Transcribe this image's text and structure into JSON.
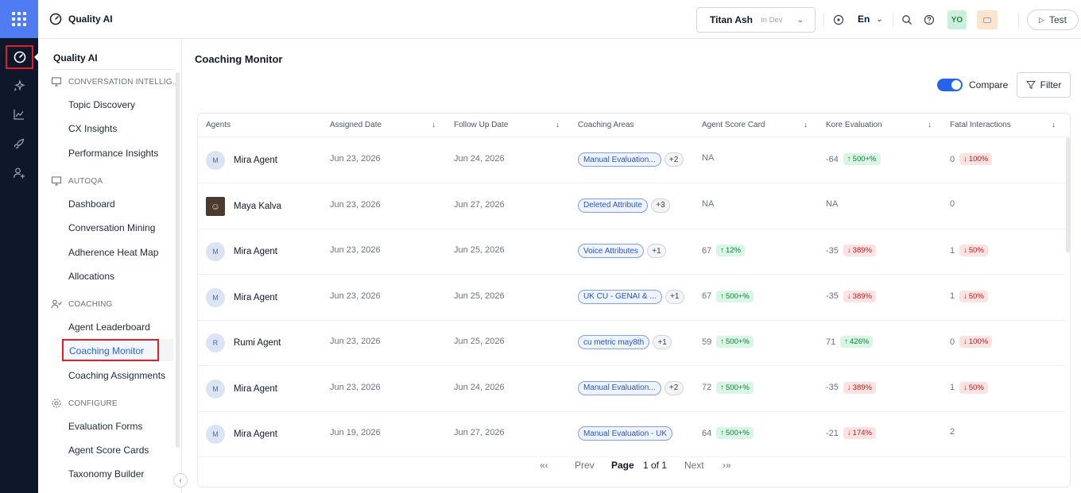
{
  "header": {
    "app_title": "Quality AI",
    "workspace_name": "Titan Ash",
    "workspace_env": "In Dev",
    "language": "En",
    "user_initials": "YO",
    "test_label": "Test"
  },
  "sidebar": {
    "title": "Quality AI",
    "sections": [
      {
        "label": "CONVERSATION INTELLIG...",
        "icon": "monitor-icon",
        "items": [
          "Topic Discovery",
          "CX Insights",
          "Performance Insights"
        ]
      },
      {
        "label": "AUTOQA",
        "icon": "monitor-icon",
        "items": [
          "Dashboard",
          "Conversation Mining",
          "Adherence Heat Map",
          "Allocations"
        ]
      },
      {
        "label": "COACHING",
        "icon": "users-icon",
        "items": [
          "Agent Leaderboard",
          "Coaching Monitor",
          "Coaching Assignments"
        ]
      },
      {
        "label": "CONFIGURE",
        "icon": "gear-icon",
        "items": [
          "Evaluation Forms",
          "Agent Score Cards",
          "Taxonomy Builder"
        ]
      }
    ],
    "active_item": "Coaching Monitor"
  },
  "main": {
    "title": "Coaching Monitor",
    "compare_label": "Compare",
    "compare_on": true,
    "filter_label": "Filter",
    "columns": [
      "Agents",
      "Assigned Date",
      "Follow Up Date",
      "Coaching Areas",
      "Agent Score Card",
      "Kore Evaluation",
      "Fatal Interactions"
    ],
    "rows": [
      {
        "initial": "M",
        "agent": "Mira Agent",
        "assigned": "Jun 23, 2026",
        "follow_up": "Jun 24, 2026",
        "area": "Manual Evaluation...",
        "more": "+2",
        "score": "NA",
        "score_badge": null,
        "kore": "-64",
        "kore_badge": {
          "dir": "up",
          "text": "500+%"
        },
        "fatal": "0",
        "fatal_badge": {
          "dir": "down",
          "text": "100%"
        }
      },
      {
        "initial": "",
        "agent": "Maya Kalva",
        "assigned": "Jun 23, 2026",
        "follow_up": "Jun 27, 2026",
        "area": "Deleted Attribute",
        "more": "+3",
        "score": "NA",
        "score_badge": null,
        "kore": "NA",
        "kore_badge": null,
        "fatal": "0",
        "fatal_badge": null
      },
      {
        "initial": "M",
        "agent": "Mira Agent",
        "assigned": "Jun 23, 2026",
        "follow_up": "Jun 25, 2026",
        "area": "Voice Attributes",
        "more": "+1",
        "score": "67",
        "score_badge": {
          "dir": "up",
          "text": "12%"
        },
        "kore": "-35",
        "kore_badge": {
          "dir": "down",
          "text": "389%"
        },
        "fatal": "1",
        "fatal_badge": {
          "dir": "down",
          "text": "50%"
        }
      },
      {
        "initial": "M",
        "agent": "Mira Agent",
        "assigned": "Jun 23, 2026",
        "follow_up": "Jun 25, 2026",
        "area": "UK CU - GENAI & ...",
        "more": "+1",
        "score": "67",
        "score_badge": {
          "dir": "up",
          "text": "500+%"
        },
        "kore": "-35",
        "kore_badge": {
          "dir": "down",
          "text": "389%"
        },
        "fatal": "1",
        "fatal_badge": {
          "dir": "down",
          "text": "50%"
        }
      },
      {
        "initial": "R",
        "agent": "Rumi Agent",
        "assigned": "Jun 23, 2026",
        "follow_up": "Jun 25, 2026",
        "area": "cu metric may8th",
        "more": "+1",
        "score": "59",
        "score_badge": {
          "dir": "up",
          "text": "500+%"
        },
        "kore": "71",
        "kore_badge": {
          "dir": "up",
          "text": "426%"
        },
        "fatal": "0",
        "fatal_badge": {
          "dir": "down",
          "text": "100%"
        }
      },
      {
        "initial": "M",
        "agent": "Mira Agent",
        "assigned": "Jun 23, 2026",
        "follow_up": "Jun 24, 2026",
        "area": "Manual Evaluation...",
        "more": "+2",
        "score": "72",
        "score_badge": {
          "dir": "up",
          "text": "500+%"
        },
        "kore": "-35",
        "kore_badge": {
          "dir": "down",
          "text": "389%"
        },
        "fatal": "1",
        "fatal_badge": {
          "dir": "down",
          "text": "50%"
        }
      },
      {
        "initial": "M",
        "agent": "Mira Agent",
        "assigned": "Jun 19, 2026",
        "follow_up": "Jun 27, 2026",
        "area": "Manual Evaluation - UK",
        "more": "",
        "score": "64",
        "score_badge": {
          "dir": "up",
          "text": "500+%"
        },
        "kore": "-21",
        "kore_badge": {
          "dir": "down",
          "text": "174%"
        },
        "fatal": "2",
        "fatal_badge": null
      }
    ],
    "pager": {
      "first": "«‹",
      "prev": "Prev",
      "page_label": "Page",
      "page_info": "1 of 1",
      "next": "Next",
      "last": "›»"
    }
  },
  "colors": {
    "accent": "#2563eb",
    "rail": "#0f172a",
    "highlight": "#e11d2a"
  }
}
